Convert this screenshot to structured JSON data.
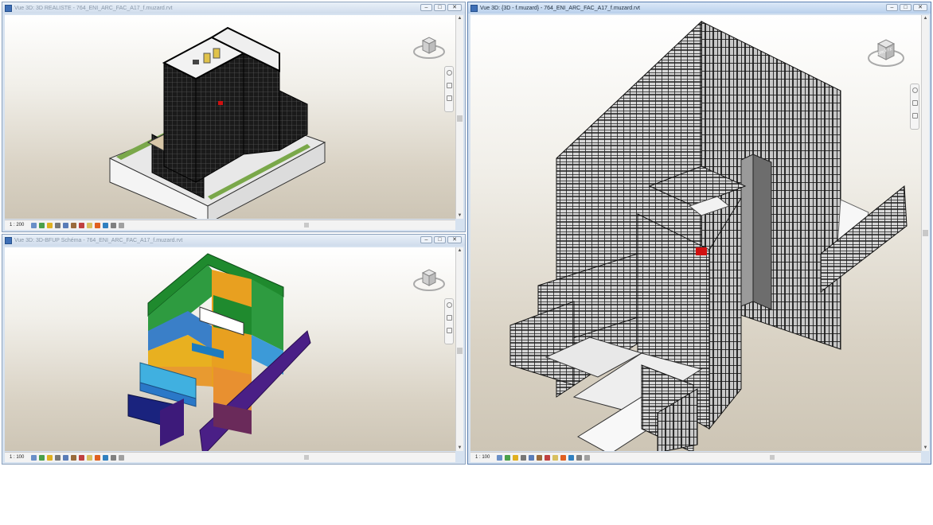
{
  "windows": {
    "realiste": {
      "title": "Vue 3D: 3D REALISTE - 764_ENI_ARC_FAC_A17_f.muzard.rvt",
      "scale": "1 : 200"
    },
    "bfup": {
      "title": "Vue 3D: 3D-BFUP Schéma - 764_ENI_ARC_FAC_A17_f.muzard.rvt",
      "scale": "1 : 100"
    },
    "main": {
      "title": "Vue 3D: {3D - f.muzard} - 764_ENI_ARC_FAC_A17_f.muzard.rvt",
      "scale": "1 : 100"
    }
  },
  "window_buttons": {
    "minimize": "–",
    "restore": "□",
    "close": "✕"
  },
  "viewcube": {
    "face_label": "DROITE"
  },
  "icons": [
    "model-graphics-icon",
    "visual-style-icon",
    "sun-path-icon",
    "shadows-icon",
    "rendering-icon",
    "crop-icon",
    "crop-visibility-icon",
    "unlock-3d-icon",
    "temporary-hide-icon",
    "reveal-hidden-icon",
    "analytical-model-icon",
    "highlight-displacement-icon"
  ],
  "colors": {
    "accent_active_title": "#1d2c3c",
    "viewport_top": "#ffffff",
    "viewport_bottom": "#cdc5b5"
  }
}
